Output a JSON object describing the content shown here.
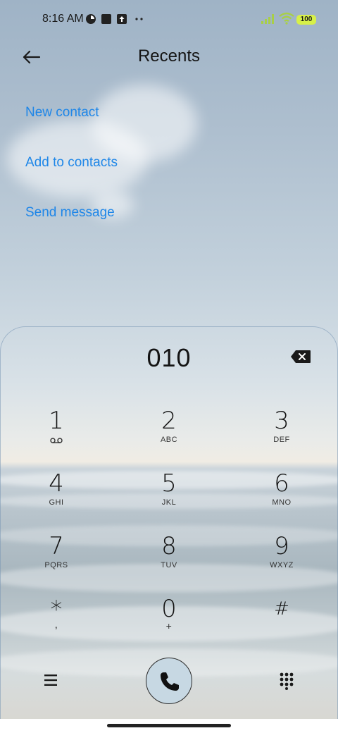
{
  "status_bar": {
    "time": "8:16 AM",
    "battery": "100",
    "icons": [
      "app-notification-icon",
      "square-notification-icon",
      "upload-notification-icon",
      "more-dots-icon",
      "signal-icon",
      "wifi-icon",
      "battery-icon"
    ]
  },
  "header": {
    "title": "Recents",
    "back_icon": "arrow-left-icon"
  },
  "actions": [
    {
      "label": "New contact"
    },
    {
      "label": "Add to contacts"
    },
    {
      "label": "Send message"
    }
  ],
  "dialer": {
    "number": "010",
    "keys": [
      {
        "digit": "1",
        "sub": ""
      },
      {
        "digit": "2",
        "sub": "ABC"
      },
      {
        "digit": "3",
        "sub": "DEF"
      },
      {
        "digit": "4",
        "sub": "GHI"
      },
      {
        "digit": "5",
        "sub": "JKL"
      },
      {
        "digit": "6",
        "sub": "MNO"
      },
      {
        "digit": "7",
        "sub": "PQRS"
      },
      {
        "digit": "8",
        "sub": "TUV"
      },
      {
        "digit": "9",
        "sub": "WXYZ"
      },
      {
        "digit": "*",
        "sub": ","
      },
      {
        "digit": "0",
        "sub": "+"
      },
      {
        "digit": "#",
        "sub": ""
      }
    ]
  },
  "bottom_bar": {
    "icons": [
      "menu-icon",
      "phone-icon",
      "dialpad-icon"
    ]
  },
  "colors": {
    "accent": "#1e86e8",
    "text": "#141414",
    "call_button": "#c7d8e3"
  }
}
